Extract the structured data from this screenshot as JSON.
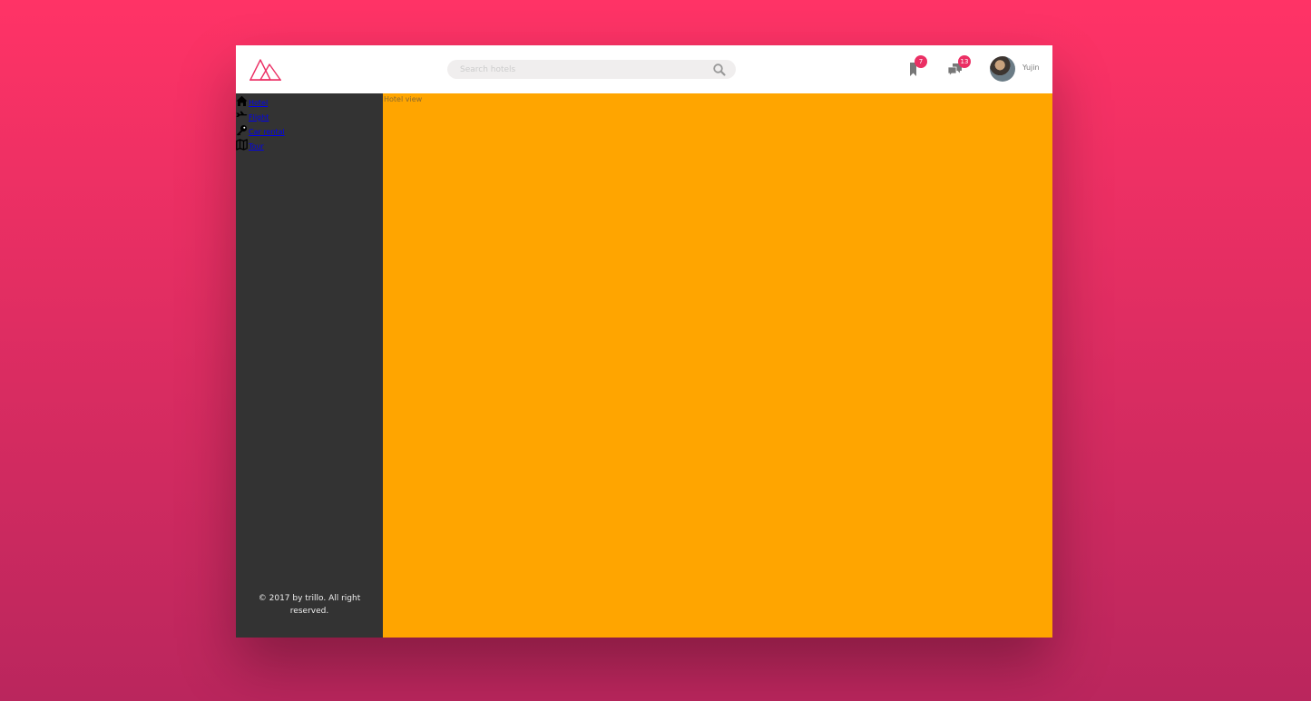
{
  "header": {
    "logo_icon": "trillo-mountains-logo-icon",
    "search": {
      "placeholder": "Search hotels",
      "icon": "magnifying-glass-icon"
    },
    "bookmarks": {
      "icon": "bookmark-icon",
      "count": "7"
    },
    "messages": {
      "icon": "chat-bubbles-icon",
      "count": "13"
    },
    "user": {
      "name": "Yujin",
      "avatar": "user-photo"
    }
  },
  "sidebar": {
    "items": [
      {
        "label": "Hotel",
        "icon": "home-icon"
      },
      {
        "label": "Flight",
        "icon": "aircraft-icon"
      },
      {
        "label": "Car rental",
        "icon": "key-icon"
      },
      {
        "label": "Tour",
        "icon": "map-icon"
      }
    ],
    "legal": "© 2017 by trillo. All right reserved."
  },
  "main": {
    "label": "Hotel view"
  },
  "colors": {
    "background_top": "#ff3366",
    "background_bottom": "#ba265d",
    "accent": "#eb2f64",
    "sidebar": "#333333",
    "hotel_view": "#ffa500"
  }
}
